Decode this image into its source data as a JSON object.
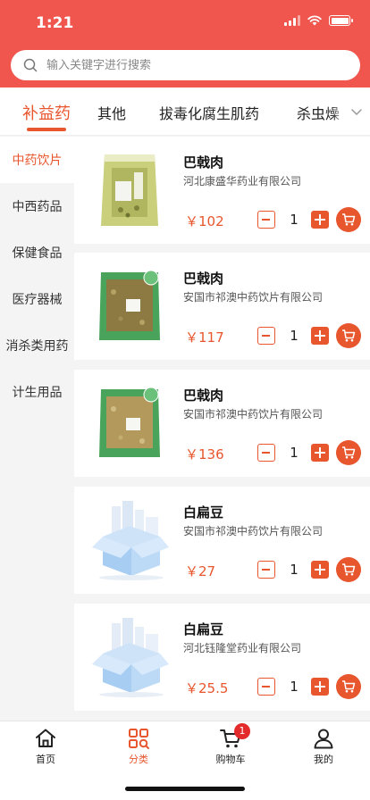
{
  "status_bar": {
    "time": "1:21"
  },
  "search": {
    "placeholder": "输入关键字进行搜索"
  },
  "top_tabs": [
    {
      "label": "补益药",
      "active": true
    },
    {
      "label": "其他"
    },
    {
      "label": "拔毒化腐生肌药"
    },
    {
      "label": "杀虫燥"
    }
  ],
  "sidebar": [
    {
      "label": "中药饮片",
      "active": true
    },
    {
      "label": "中西药品"
    },
    {
      "label": "保健食品"
    },
    {
      "label": "医疗器械"
    },
    {
      "label": "消杀类用药"
    },
    {
      "label": "计生用品"
    }
  ],
  "products": [
    {
      "name": "巴戟肉",
      "maker": "河北康盛华药业有限公司",
      "price": "￥102",
      "qty": "1",
      "image": "herb-bag-yellow"
    },
    {
      "name": "巴戟肉",
      "maker": "安国市祁澳中药饮片有限公司",
      "price": "￥117",
      "qty": "1",
      "image": "herb-bag-green"
    },
    {
      "name": "巴戟肉",
      "maker": "安国市祁澳中药饮片有限公司",
      "price": "￥136",
      "qty": "1",
      "image": "herb-bag-green"
    },
    {
      "name": "白扁豆",
      "maker": "安国市祁澳中药饮片有限公司",
      "price": "￥27",
      "qty": "1",
      "image": "placeholder-box"
    },
    {
      "name": "白扁豆",
      "maker": "河北钰隆堂药业有限公司",
      "price": "￥25.5",
      "qty": "1",
      "image": "placeholder-box"
    }
  ],
  "tabbar": {
    "home": "首页",
    "category": "分类",
    "cart": "购物车",
    "cart_badge": "1",
    "mine": "我的"
  },
  "colors": {
    "brand": "#f0554e",
    "accent": "#e8562e",
    "badge": "#e32b2b"
  },
  "icons": [
    "search-icon",
    "chevron-down-icon",
    "cart-icon",
    "home-icon",
    "category-icon",
    "cart-tab-icon",
    "user-icon"
  ]
}
